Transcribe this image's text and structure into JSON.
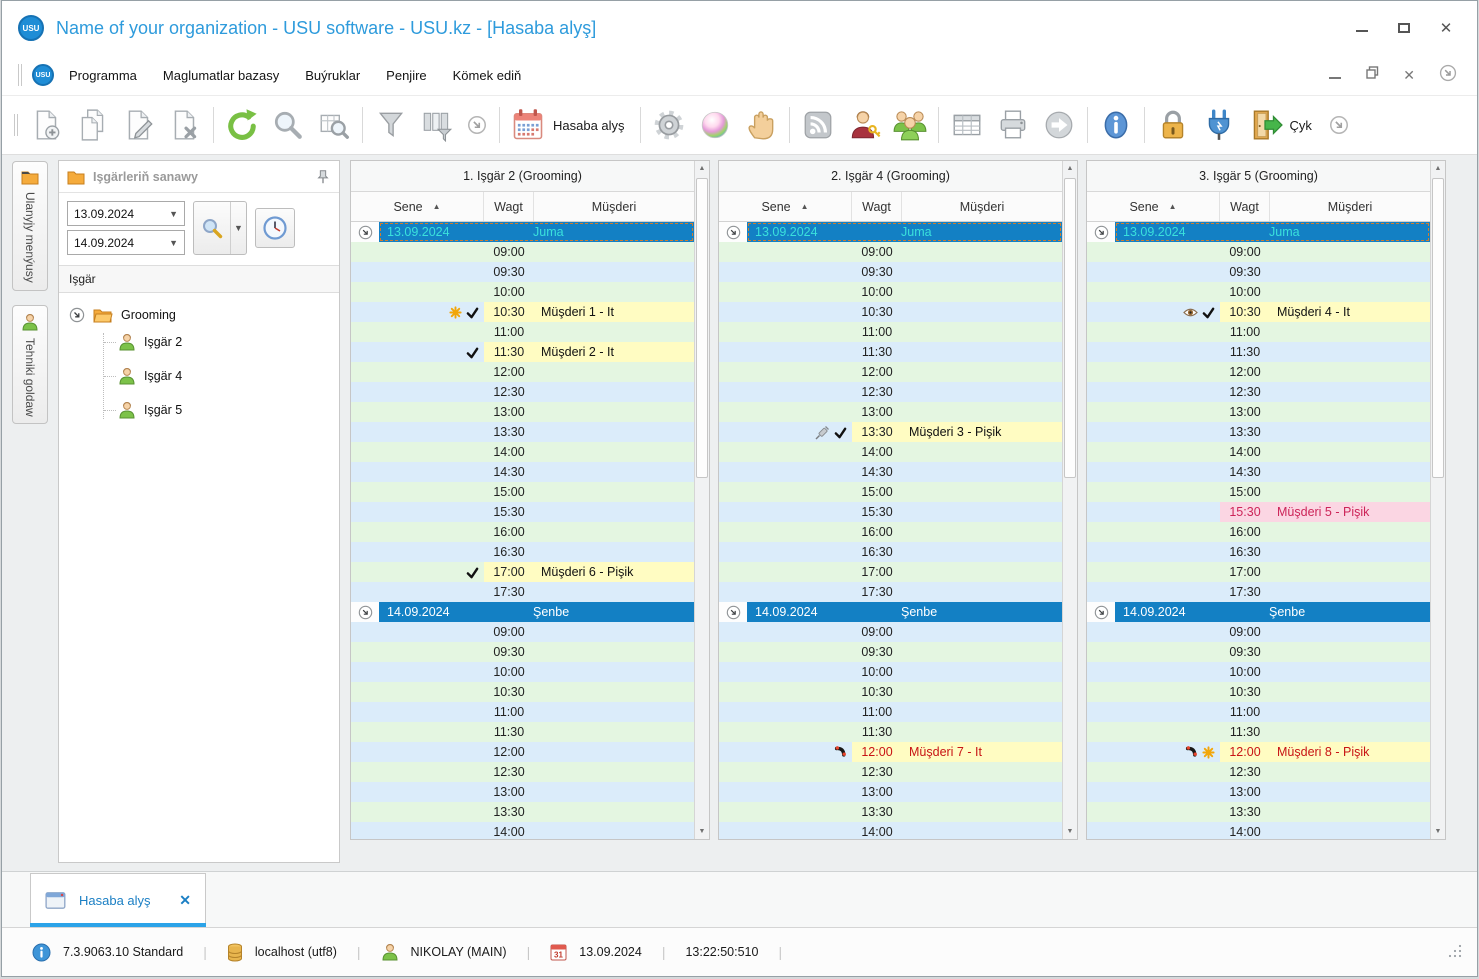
{
  "window": {
    "title": "Name of your organization - USU software - USU.kz - [Hasaba alyş]",
    "controls": [
      "minimize",
      "maximize",
      "close"
    ]
  },
  "menu": {
    "items": [
      "Programma",
      "Maglumatlar bazasy",
      "Buýruklar",
      "Penjire",
      "Kömek ediň"
    ],
    "mdi_controls": [
      "minimize",
      "restore",
      "close",
      "overflow"
    ]
  },
  "toolbar": {
    "module_label": "Hasaba alyş",
    "exit_label": "Çyk",
    "icons": [
      "new-record",
      "copy-record",
      "edit-record",
      "delete-record",
      "refresh",
      "search",
      "search-advanced",
      "filter",
      "filter-panel",
      "overflow-chevron",
      "calendar",
      "settings-gear",
      "color-ball",
      "hand",
      "feed",
      "user-key",
      "users-group",
      "table-grid",
      "printer",
      "go-arrow",
      "info",
      "lock",
      "plug",
      "exit-door",
      "overflow-chevron"
    ]
  },
  "sidebar": {
    "tabs": [
      {
        "label": "Ulanyjy menýusy",
        "icon": "folder-icon"
      },
      {
        "label": "Tehniki goldaw",
        "icon": "person-icon"
      }
    ],
    "panel_title": "Işgärleriň sanawy",
    "date_from": "13.09.2024",
    "date_to": "14.09.2024",
    "tree_header": "Işgär",
    "tree": {
      "root": "Grooming",
      "children": [
        "Işgär 2",
        "Işgär 4",
        "Işgär 5"
      ]
    }
  },
  "schedule": {
    "headers": {
      "date": "Sene",
      "time": "Wagt",
      "client": "Müşderi"
    },
    "days": [
      {
        "date": "13.09.2024",
        "weekday": "Juma"
      },
      {
        "date": "14.09.2024",
        "weekday": "Şenbe"
      }
    ],
    "times_day1": [
      "09:00",
      "09:30",
      "10:00",
      "10:30",
      "11:00",
      "11:30",
      "12:00",
      "12:30",
      "13:00",
      "13:30",
      "14:00",
      "14:30",
      "15:00",
      "15:30",
      "16:00",
      "16:30",
      "17:00",
      "17:30"
    ],
    "times_day2": [
      "09:00",
      "09:30",
      "10:00",
      "10:30",
      "11:00",
      "11:30",
      "12:00",
      "12:30",
      "13:00",
      "13:30",
      "14:00"
    ],
    "panels": [
      {
        "title": "1. Işgär 2 (Grooming)",
        "appointments": [
          {
            "day": 0,
            "time": "10:30",
            "client": "Müşderi 1 - It",
            "icons": [
              "star",
              "check"
            ],
            "style": "yellow"
          },
          {
            "day": 0,
            "time": "11:30",
            "client": "Müşderi 2 - It",
            "icons": [
              "check"
            ],
            "style": "yellow"
          },
          {
            "day": 0,
            "time": "17:00",
            "client": "Müşderi 6 - Pişik",
            "icons": [
              "check"
            ],
            "style": "yellow"
          }
        ]
      },
      {
        "title": "2. Işgär 4 (Grooming)",
        "appointments": [
          {
            "day": 0,
            "time": "13:30",
            "client": "Müşderi 3 - Pişik",
            "icons": [
              "syringe",
              "check"
            ],
            "style": "yellow"
          },
          {
            "day": 1,
            "time": "12:00",
            "client": "Müşderi 7 - It",
            "icons": [
              "phone"
            ],
            "style": "yellow-red"
          }
        ]
      },
      {
        "title": "3. Işgär 5 (Grooming)",
        "appointments": [
          {
            "day": 0,
            "time": "10:30",
            "client": "Müşderi 4 - It",
            "icons": [
              "eye",
              "check"
            ],
            "style": "yellow"
          },
          {
            "day": 0,
            "time": "15:30",
            "client": "Müşderi 5 - Pişik",
            "icons": [],
            "style": "pink"
          },
          {
            "day": 1,
            "time": "12:00",
            "client": "Müşderi 8 - Pişik",
            "icons": [
              "phone",
              "star"
            ],
            "style": "yellow-red"
          }
        ]
      }
    ]
  },
  "tabbar": {
    "active_tab": "Hasaba alyş"
  },
  "statusbar": {
    "version": "7.3.9063.10 Standard",
    "host": "localhost (utf8)",
    "user": "NIKOLAY (MAIN)",
    "date": "13.09.2024",
    "time": "13:22:50:510"
  },
  "colors": {
    "title_text": "#2e9bdc",
    "date_bar_blue": "#1380c4",
    "today_text_cyan": "#3ae0dc",
    "row_green": "#e4f6e1",
    "row_blue": "#dbecfa",
    "appointment_yellow": "#fffcc2",
    "appointment_pink": "#fbd6e3",
    "alert_red": "#c81414",
    "tab_underline": "#2ba3e8"
  }
}
